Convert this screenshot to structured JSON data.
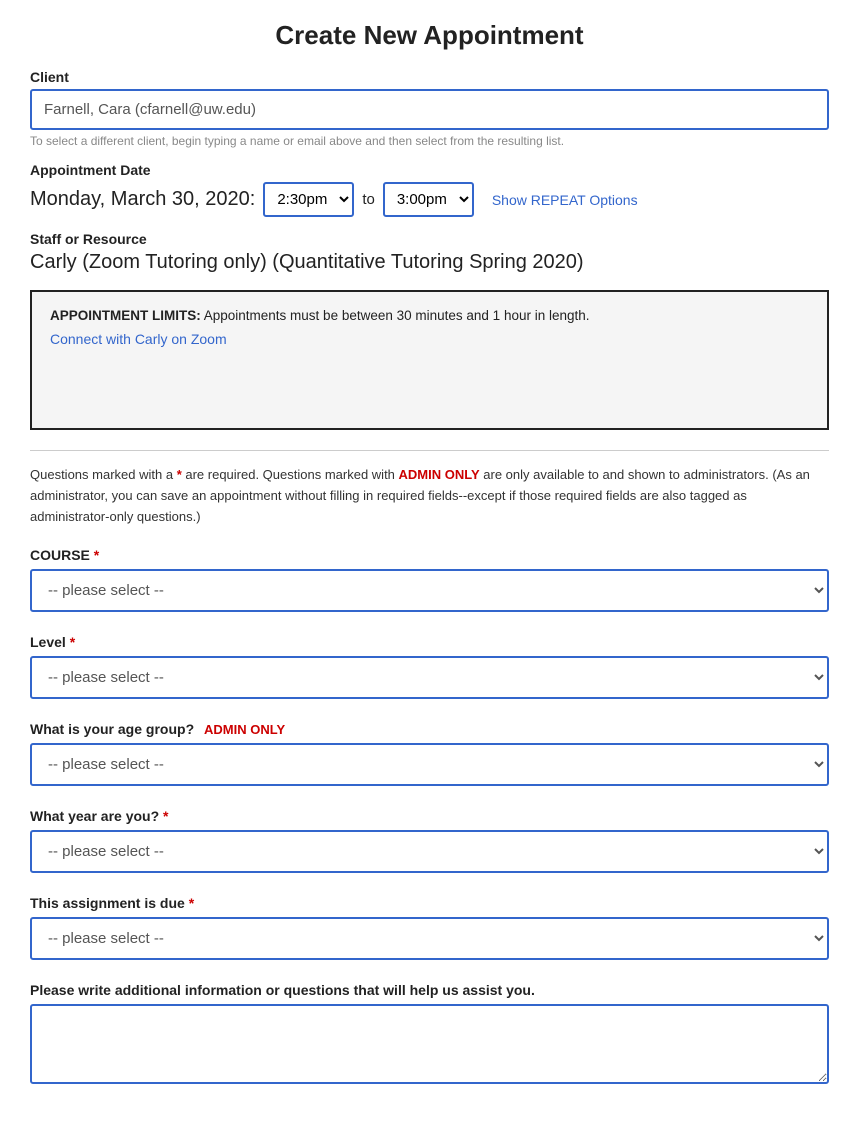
{
  "page": {
    "title": "Create New Appointment"
  },
  "client": {
    "label": "Client",
    "value": "Farnell, Cara (cfarnell@uw.edu)",
    "hint": "To select a different client, begin typing a name or email above and then select from the resulting list."
  },
  "appointment_date": {
    "label": "Appointment Date",
    "date": "Monday, March 30, 2020:",
    "start_time": "2:30pm",
    "to_label": "to",
    "end_time": "3:00pm",
    "repeat_link": "Show REPEAT Options"
  },
  "staff": {
    "label": "Staff or Resource",
    "name": "Carly (Zoom Tutoring only) (Quantitative Tutoring Spring 2020)"
  },
  "limits_box": {
    "bold_text": "APPOINTMENT LIMITS:",
    "text": " Appointments must be between 30 minutes and 1 hour in length.",
    "zoom_link": "Connect with Carly on Zoom"
  },
  "instructions": {
    "text1": "Questions marked with a ",
    "star": "*",
    "text2": " are required. Questions marked with ",
    "admin_only": "ADMIN ONLY",
    "text3": " are only available to and shown to administrators. (As an administrator, you can save an appointment without filling in required fields--except if those required fields are also tagged as administrator-only questions.)"
  },
  "form": {
    "course": {
      "label": "COURSE",
      "required": true,
      "placeholder": "-- please select --"
    },
    "level": {
      "label": "Level",
      "required": true,
      "placeholder": "-- please select --"
    },
    "age_group": {
      "label": "What is your age group?",
      "admin_only": true,
      "placeholder": "-- please select --"
    },
    "year": {
      "label": "What year are you?",
      "required": true,
      "placeholder": "-- please select --"
    },
    "assignment_due": {
      "label": "This assignment is due",
      "required": true,
      "placeholder": "-- please select --"
    },
    "additional_info": {
      "label": "Please write additional information or questions that will help us assist you."
    }
  }
}
